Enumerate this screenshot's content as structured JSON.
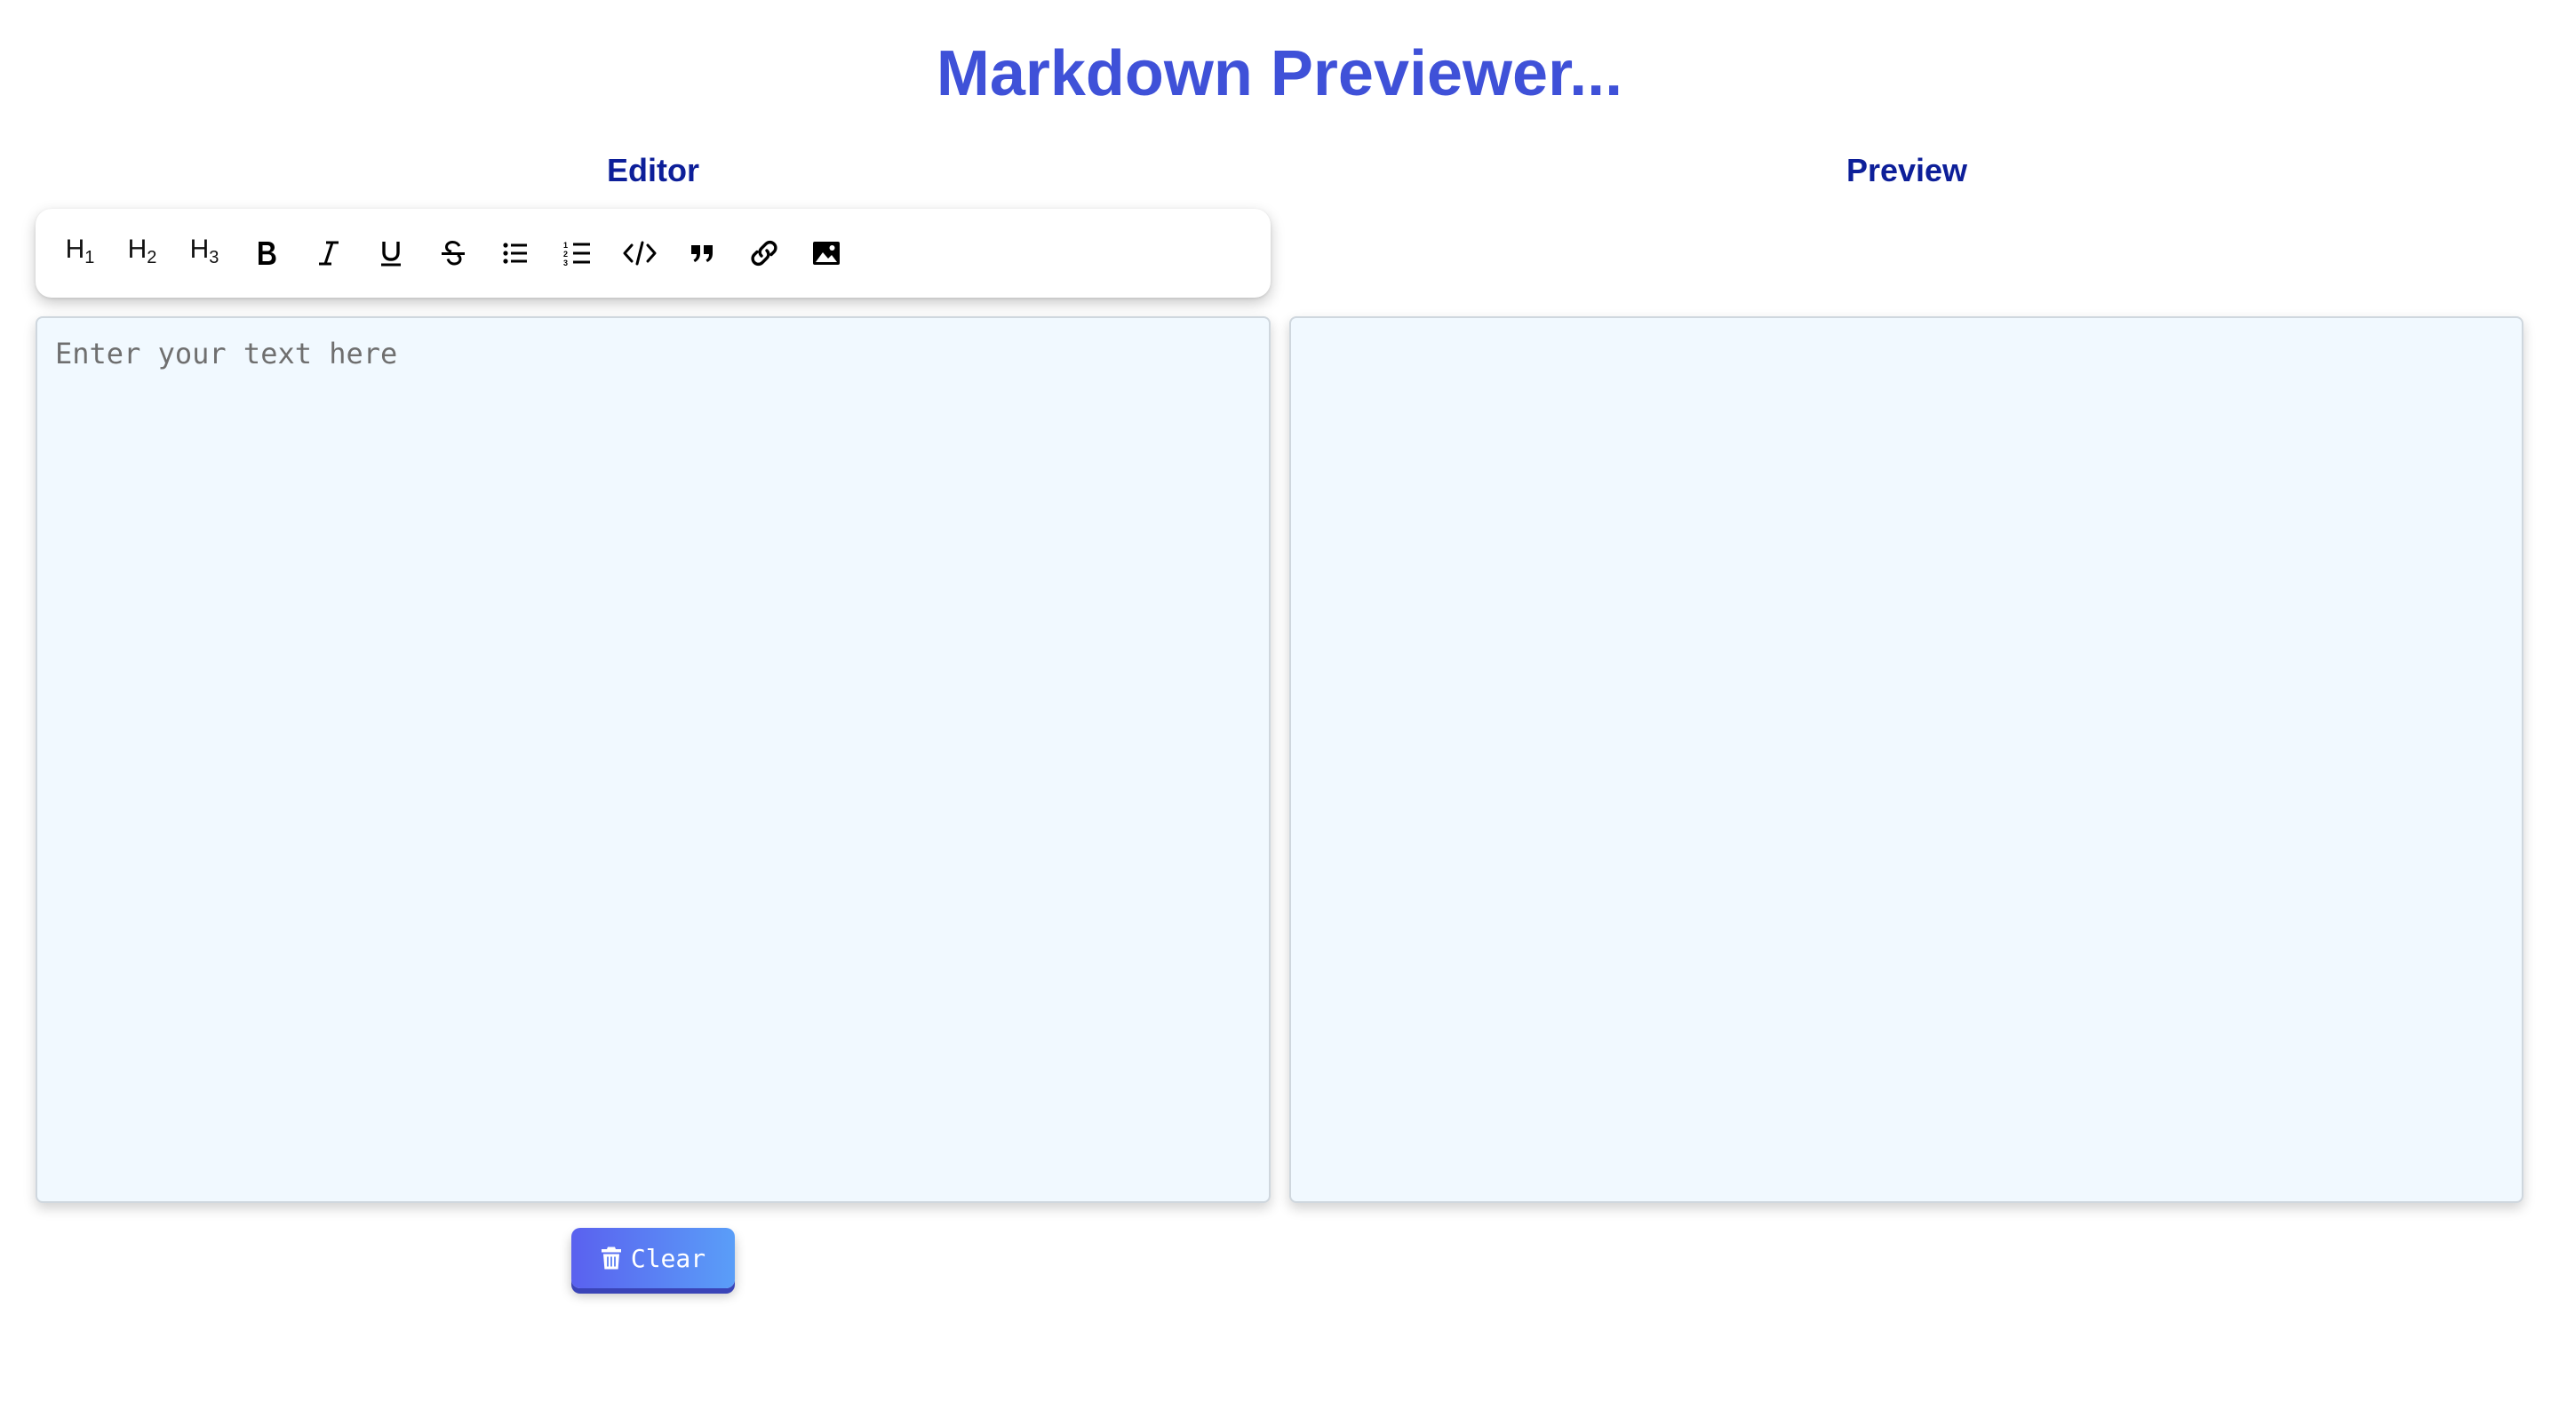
{
  "header": {
    "title": "Markdown Previewer..."
  },
  "editor": {
    "heading": "Editor",
    "placeholder": "Enter your text here",
    "value": ""
  },
  "preview": {
    "heading": "Preview",
    "content": ""
  },
  "toolbar": {
    "h1": {
      "base": "H",
      "sub": "1"
    },
    "h2": {
      "base": "H",
      "sub": "2"
    },
    "h3": {
      "base": "H",
      "sub": "3"
    },
    "icons": [
      "bold-icon",
      "italic-icon",
      "underline-icon",
      "strikethrough-icon",
      "bulleted-list-icon",
      "numbered-list-icon",
      "code-icon",
      "quote-icon",
      "link-icon",
      "image-icon"
    ]
  },
  "actions": {
    "clear_label": "Clear",
    "clear_icon": "trash-icon"
  },
  "colors": {
    "title": "#3f51d8",
    "heading": "#0d1f99",
    "pane_background": "#f1f9ff",
    "button_gradient_start": "#5a61ef",
    "button_gradient_end": "#5a9ef8"
  }
}
